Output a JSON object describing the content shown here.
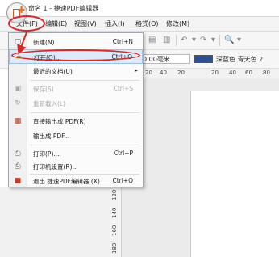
{
  "window": {
    "title": "命名 1 - 捷速PDF编辑器"
  },
  "menubar": {
    "items": [
      {
        "label": "文件(F)"
      },
      {
        "label": "编辑(E)"
      },
      {
        "label": "视图(V)"
      },
      {
        "label": "插入(I)"
      },
      {
        "label": "格式(O)"
      },
      {
        "label": "修改(M)"
      }
    ]
  },
  "toolbar": {
    "unit_value": "0.00毫米",
    "color_label": "深蓝色 青天色 2"
  },
  "ruler": {
    "ticks": [
      "20",
      "40",
      "20",
      "20",
      "40",
      "60",
      "80"
    ]
  },
  "vruler": {
    "ticks": [
      "120",
      "140",
      "160",
      "180"
    ]
  },
  "file_menu": {
    "items": [
      {
        "label": "新建(N)",
        "shortcut": "Ctrl+N",
        "icon": "new-doc-icon",
        "disabled": false
      },
      {
        "label": "打开(O)...",
        "shortcut": "Ctrl+O",
        "icon": "open-folder-icon",
        "disabled": false
      },
      {
        "label": "最近的文档(U)",
        "shortcut": "",
        "icon": "",
        "disabled": false,
        "submenu": true
      },
      {
        "label": "保存(S)",
        "shortcut": "Ctrl+S",
        "icon": "save-icon",
        "disabled": true
      },
      {
        "label": "重新载入(L)",
        "shortcut": "",
        "icon": "reload-icon",
        "disabled": true
      },
      {
        "label": "直接输出成 PDF(R)",
        "shortcut": "",
        "icon": "export-pdf-icon",
        "disabled": false
      },
      {
        "label": "输出成 PDF...",
        "shortcut": "",
        "icon": "",
        "disabled": false
      },
      {
        "label": "打印(P)...",
        "shortcut": "Ctrl+P",
        "icon": "print-icon",
        "disabled": false
      },
      {
        "label": "打印机设置(R)...",
        "shortcut": "",
        "icon": "printer-settings-icon",
        "disabled": false
      },
      {
        "label": "退出 捷速PDF编辑器 (X)",
        "shortcut": "Ctrl+Q",
        "icon": "exit-icon",
        "disabled": false
      }
    ]
  },
  "colors": {
    "annotation": "#d12a2a",
    "accent": "#2e4f8f"
  }
}
